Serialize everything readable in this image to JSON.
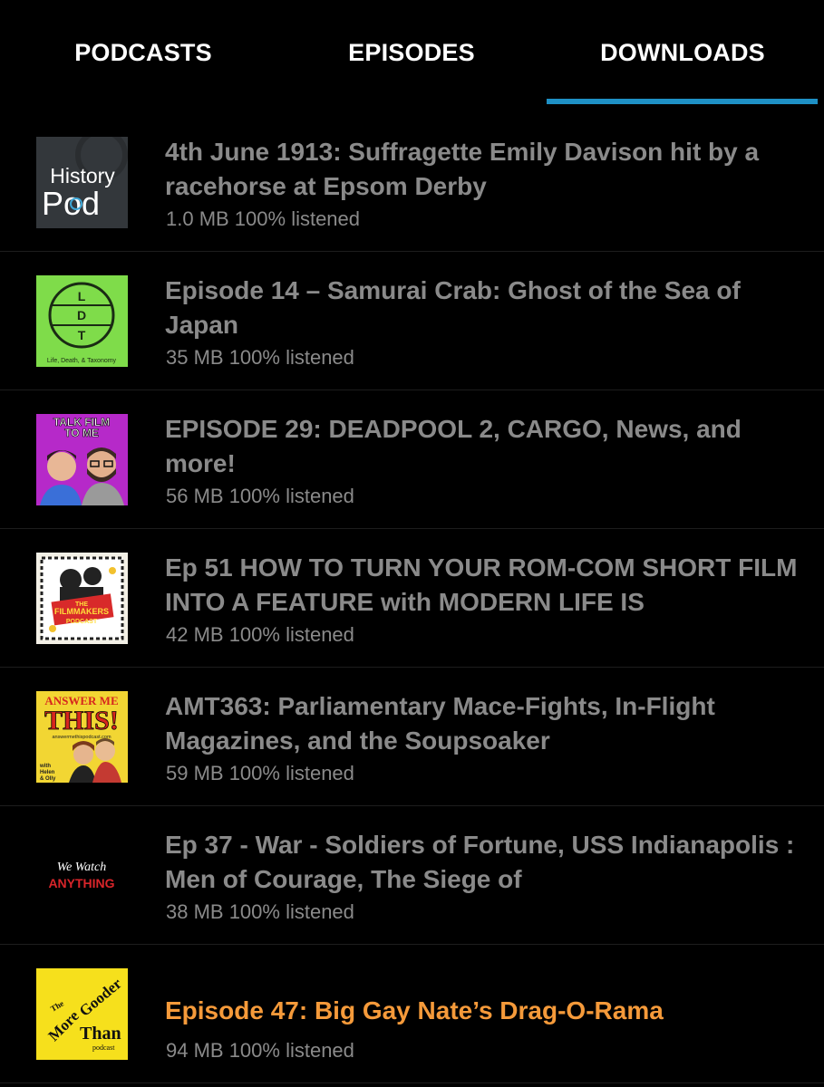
{
  "tabs": [
    {
      "label": "PODCASTS"
    },
    {
      "label": "EPISODES"
    },
    {
      "label": "DOWNLOADS"
    }
  ],
  "active_tab": "DOWNLOADS",
  "accent_color": "#1e90c5",
  "playing_color": "#f59a3a",
  "downloads": [
    {
      "title": "4th June 1913: Suffragette Emily Davison hit by a racehorse at Epsom Derby",
      "meta": "1.0 MB 100% listened",
      "art": {
        "icon": "history-pod-art",
        "line1": "History",
        "line2": "Pod"
      }
    },
    {
      "title": "Episode 14 – Samurai Crab: Ghost of the Sea of Japan",
      "meta": "35 MB 100% listened",
      "art": {
        "icon": "ldt-art",
        "letters": "LDT",
        "caption": "Life, Death, & Taxonomy"
      }
    },
    {
      "title": "EPISODE 29: DEADPOOL 2, CARGO, News, and more!",
      "meta": "56 MB 100% listened",
      "art": {
        "icon": "talk-film-to-me-art",
        "line1": "TALK FILM",
        "line2": "TO ME"
      }
    },
    {
      "title": "Ep 51 HOW TO TURN YOUR ROM-COM SHORT FILM INTO A FEATURE with MODERN LIFE IS",
      "meta": "42 MB 100% listened",
      "art": {
        "icon": "filmmakers-podcast-art",
        "line1": "THE",
        "line2": "FILMMAKERS",
        "line3": "PODCAST"
      }
    },
    {
      "title": "AMT363: Parliamentary Mace-Fights, In-Flight Magazines, and the Soupsoaker",
      "meta": "59 MB 100% listened",
      "art": {
        "icon": "answer-me-this-art",
        "line1": "ANSWER ME",
        "line2": "THIS!",
        "line3": "answermethispodcast.com",
        "line4": "with Helen & Olly"
      }
    },
    {
      "title": "Ep 37 - War - Soldiers of Fortune, USS Indianapolis : Men of Courage, The Siege of",
      "meta": "38 MB 100% listened",
      "art": {
        "icon": "we-watch-anything-art",
        "line1": "We Watch",
        "line2": "ANYTHING"
      }
    },
    {
      "title": "Episode 47: Big Gay Nate’s Drag-O-Rama",
      "meta": "94 MB 100% listened",
      "playing": true,
      "art": {
        "icon": "more-gooder-than-art",
        "line1": "The",
        "line2": "More",
        "line3": "Gooder",
        "line4": "Than",
        "line5": "podcast"
      }
    }
  ]
}
